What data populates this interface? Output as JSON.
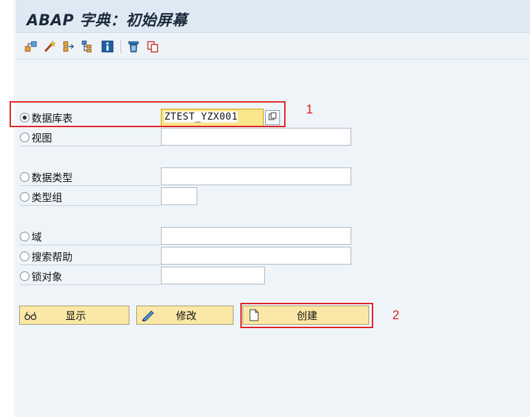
{
  "window": {
    "title": "ABAP 字典：初始屏幕"
  },
  "toolbar": {
    "buttons": [
      "other-object-icon",
      "activate-wand-icon",
      "where-used-icon",
      "hierarchy-icon",
      "info-icon",
      "delete-icon",
      "copy-icon"
    ]
  },
  "options": [
    {
      "label": "数据库表",
      "checked": true,
      "value": "ZTEST_YZX001"
    },
    {
      "label": "视图",
      "checked": false,
      "value": ""
    },
    {
      "label": "数据类型",
      "checked": false,
      "value": ""
    },
    {
      "label": "类型组",
      "checked": false,
      "value": ""
    },
    {
      "label": "域",
      "checked": false,
      "value": ""
    },
    {
      "label": "搜索帮助",
      "checked": false,
      "value": ""
    },
    {
      "label": "锁对象",
      "checked": false,
      "value": ""
    }
  ],
  "actions": {
    "display": "显示",
    "change": "修改",
    "create": "创建"
  },
  "annotations": {
    "first": "1",
    "second": "2"
  },
  "colors": {
    "highlight": "#e02020",
    "button_bg": "#fbe8a6",
    "active_field": "#fbe58b"
  }
}
